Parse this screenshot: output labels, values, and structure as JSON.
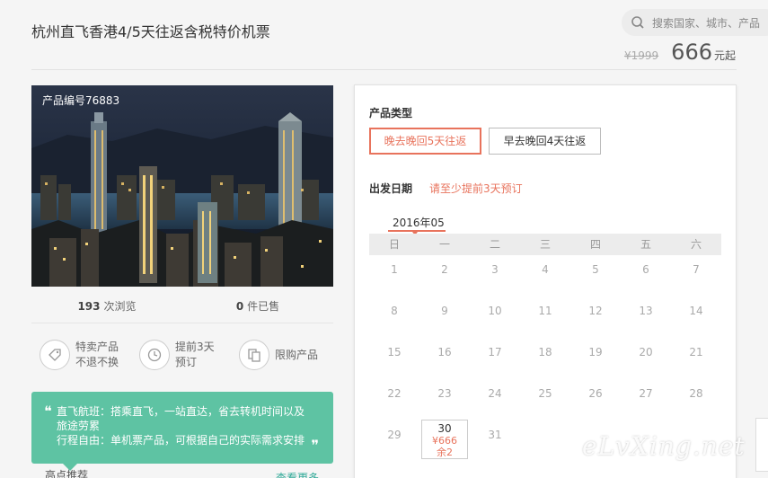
{
  "header": {
    "title": "杭州直飞香港4/5天往返含税特价机票",
    "search_placeholder": "搜索国家、城市、产品",
    "old_price": "¥1999",
    "price": "666",
    "price_unit": "元起"
  },
  "product": {
    "number_label": "产品编号76883",
    "views_count": "193",
    "views_label": "次浏览",
    "sold_count": "0",
    "sold_label": "件已售"
  },
  "features": [
    {
      "icon": "tag-icon",
      "line1": "特卖产品",
      "line2": "不退不换"
    },
    {
      "icon": "clock-icon",
      "line1": "提前3天",
      "line2": "预订"
    },
    {
      "icon": "copy-icon",
      "line1": "限购产品",
      "line2": ""
    }
  ],
  "highlight": {
    "line1": "直飞航班：搭乘直飞，一站直达，省去转机时间以及",
    "line2": "旅途劳累",
    "line3": "行程自由：单机票产品，可根据自己的实际需求安排"
  },
  "recommend": {
    "label": "高点推荐",
    "more": "查看更多"
  },
  "booking": {
    "type_label": "产品类型",
    "options": [
      {
        "label": "晚去晚回5天往返",
        "selected": true
      },
      {
        "label": "早去晚回4天往返",
        "selected": false
      }
    ],
    "date_label": "出发日期",
    "date_tip": "请至少提前3天预订",
    "month": "2016年05",
    "weekdays": [
      "日",
      "一",
      "二",
      "三",
      "四",
      "五",
      "六"
    ],
    "days": [
      "1",
      "2",
      "3",
      "4",
      "5",
      "6",
      "7",
      "8",
      "9",
      "10",
      "11",
      "12",
      "13",
      "14",
      "15",
      "16",
      "17",
      "18",
      "19",
      "20",
      "21",
      "22",
      "23",
      "24",
      "25",
      "26",
      "27",
      "28",
      "29",
      "30",
      "31"
    ],
    "available_day": {
      "day": "30",
      "price": "¥666",
      "stock": "余2"
    }
  },
  "watermark": "eLvXing.net",
  "colors": {
    "accent": "#e8735c",
    "green": "#5ec3a3"
  }
}
